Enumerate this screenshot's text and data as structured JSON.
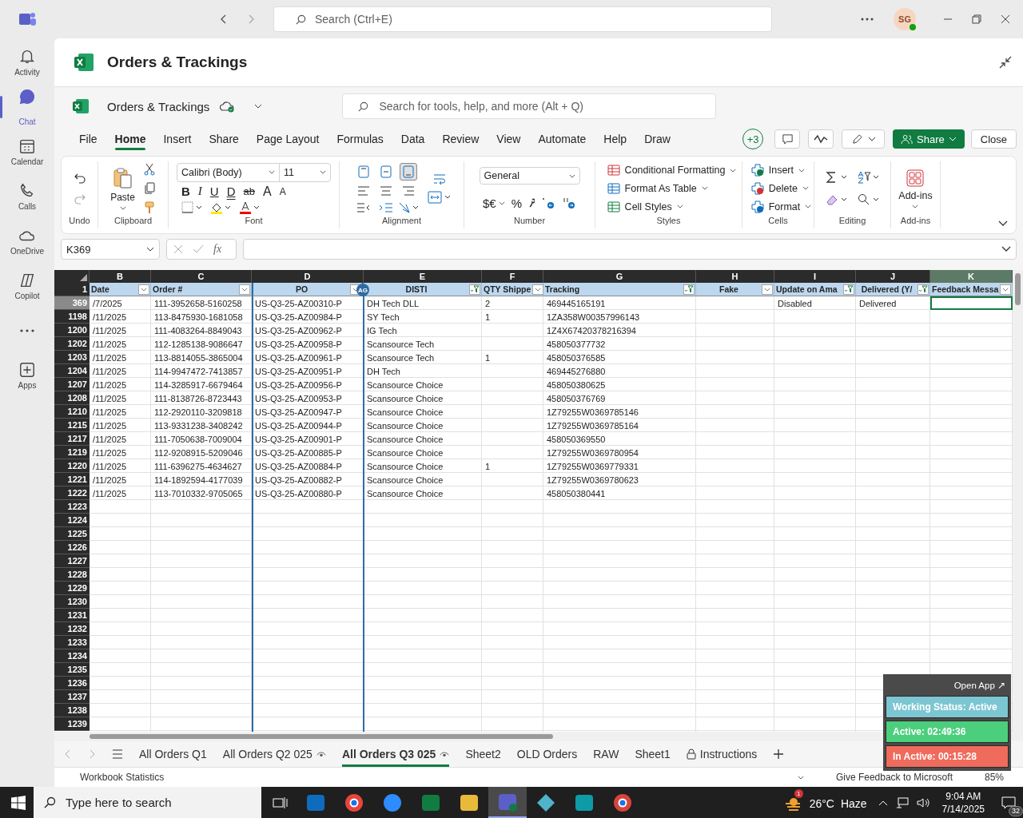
{
  "app_bar": {
    "search_placeholder": "Search (Ctrl+E)",
    "avatar": "SG"
  },
  "rail": [
    {
      "kind": "bell",
      "label": "Activity",
      "selected": false
    },
    {
      "kind": "chat",
      "label": "Chat",
      "selected": true
    },
    {
      "kind": "calendar",
      "label": "Calendar",
      "selected": false
    },
    {
      "kind": "calls",
      "label": "Calls",
      "selected": false
    },
    {
      "kind": "cloud",
      "label": "OneDrive",
      "selected": false
    },
    {
      "kind": "copilot",
      "label": "Copilot",
      "selected": false
    },
    {
      "kind": "more",
      "selected": false
    },
    {
      "kind": "apps",
      "label": "Apps",
      "selected": false
    }
  ],
  "document": {
    "title": "Orders & Trackings"
  },
  "workbook": {
    "name": "Orders & Trackings",
    "search_placeholder": "Search for tools, help, and more (Alt + Q)"
  },
  "menu_tabs": [
    {
      "label": "File",
      "selected": false
    },
    {
      "label": "Home",
      "selected": true
    },
    {
      "label": "Insert",
      "selected": false
    },
    {
      "label": "Share",
      "selected": false
    },
    {
      "label": "Page Layout",
      "selected": false
    },
    {
      "label": "Formulas",
      "selected": false
    },
    {
      "label": "Data",
      "selected": false
    },
    {
      "label": "Review",
      "selected": false
    },
    {
      "label": "View",
      "selected": false
    },
    {
      "label": "Automate",
      "selected": false
    },
    {
      "label": "Help",
      "selected": false
    },
    {
      "label": "Draw",
      "selected": false
    }
  ],
  "toolbar": {
    "collaborators": "+3",
    "share": "Share",
    "close": "Close"
  },
  "ribbon": {
    "undo": {
      "label": "Undo"
    },
    "clipboard": {
      "paste": "Paste",
      "label": "Clipboard"
    },
    "font": {
      "name": "Calibri (Body)",
      "size": "11",
      "label": "Font",
      "buttons": [
        {
          "kind": "bold",
          "label": "B"
        },
        {
          "kind": "italic",
          "label": "I"
        },
        {
          "kind": "underline",
          "label": "U"
        },
        {
          "kind": "double",
          "label": "D"
        },
        {
          "kind": "strike",
          "label": "ab"
        },
        {
          "kind": "grow",
          "label": "A"
        },
        {
          "kind": "shrink",
          "label": "A"
        }
      ]
    },
    "alignment": {
      "label": "Alignment",
      "vertical": [
        {
          "kind": "top",
          "selected": false
        },
        {
          "kind": "middle",
          "selected": false
        },
        {
          "kind": "bottom",
          "selected": true
        }
      ]
    },
    "number": {
      "format": "General",
      "currency": "$€",
      "percent": "%",
      "label": "Number"
    },
    "styles": {
      "label": "Styles",
      "items": [
        {
          "kind": "conditional",
          "label": "Conditional Formatting"
        },
        {
          "kind": "table",
          "label": "Format As Table"
        },
        {
          "kind": "cellstyles",
          "label": "Cell Styles"
        }
      ]
    },
    "cells": {
      "label": "Cells",
      "items": [
        {
          "kind": "insert",
          "label": "Insert"
        },
        {
          "kind": "delete",
          "label": "Delete"
        },
        {
          "kind": "format",
          "label": "Format"
        }
      ]
    },
    "editing": {
      "label": "Editing"
    },
    "addins": {
      "button": "Add-ins",
      "label": "Add-ins"
    }
  },
  "formula_bar": {
    "name_box": "K369",
    "function_label": "fx"
  },
  "sheet": {
    "columns": [
      {
        "letter": "B",
        "header": "Date",
        "filtered": false,
        "selected": false
      },
      {
        "letter": "C",
        "header": "Order #",
        "filtered": false,
        "selected": false
      },
      {
        "letter": "D",
        "header": "PO",
        "filtered": false,
        "selected": false,
        "co_author": "AG"
      },
      {
        "letter": "E",
        "header": "DISTI",
        "filtered": true,
        "selected": false
      },
      {
        "letter": "F",
        "header": "QTY Shippe",
        "filtered": false,
        "selected": false
      },
      {
        "letter": "G",
        "header": "Tracking",
        "filtered": true,
        "selected": false
      },
      {
        "letter": "H",
        "header": "Fake",
        "filtered": false,
        "selected": false
      },
      {
        "letter": "I",
        "header": "Update on Ama",
        "filtered": true,
        "selected": false
      },
      {
        "letter": "J",
        "header": "Delivered (Y/",
        "filtered": true,
        "selected": false
      },
      {
        "letter": "K",
        "header": "Feedback Messa",
        "filtered": false,
        "selected": true
      }
    ],
    "header_row": "1",
    "rows": [
      {
        "number": "369",
        "selected": true,
        "cells": {
          "B": "/7/2025",
          "C": "111-3952658-5160258",
          "D": "US-Q3-25-AZ00310-P",
          "E": "DH Tech DLL",
          "F": "2",
          "G": "469445165191",
          "I": "Disabled",
          "J": "Delivered"
        }
      },
      {
        "number": "1198",
        "selected": false,
        "cells": {
          "B": "/11/2025",
          "C": "113-8475930-1681058",
          "D": "US-Q3-25-AZ00984-P",
          "E": "SY Tech",
          "F": "1",
          "G": "1ZA358W00357996143"
        }
      },
      {
        "number": "1200",
        "selected": false,
        "cells": {
          "B": "/11/2025",
          "C": "111-4083264-8849043",
          "D": "US-Q3-25-AZ00962-P",
          "E": "IG Tech",
          "G": "1Z4X67420378216394"
        }
      },
      {
        "number": "1202",
        "selected": false,
        "cells": {
          "B": "/11/2025",
          "C": "112-1285138-9086647",
          "D": "US-Q3-25-AZ00958-P",
          "E": "Scansource Tech",
          "G": "458050377732"
        }
      },
      {
        "number": "1203",
        "selected": false,
        "cells": {
          "B": "/11/2025",
          "C": "113-8814055-3865004",
          "D": "US-Q3-25-AZ00961-P",
          "E": "Scansource Tech",
          "F": "1",
          "G": "458050376585"
        }
      },
      {
        "number": "1204",
        "selected": false,
        "cells": {
          "B": "/11/2025",
          "C": "114-9947472-7413857",
          "D": "US-Q3-25-AZ00951-P",
          "E": "DH Tech",
          "G": "469445276880"
        }
      },
      {
        "number": "1207",
        "selected": false,
        "cells": {
          "B": "/11/2025",
          "C": "114-3285917-6679464",
          "D": "US-Q3-25-AZ00956-P",
          "E": "Scansource Choice",
          "G": "458050380625"
        }
      },
      {
        "number": "1208",
        "selected": false,
        "cells": {
          "B": "/11/2025",
          "C": "111-8138726-8723443",
          "D": "US-Q3-25-AZ00953-P",
          "E": "Scansource Choice",
          "G": "458050376769"
        }
      },
      {
        "number": "1210",
        "selected": false,
        "cells": {
          "B": "/11/2025",
          "C": "112-2920110-3209818",
          "D": "US-Q3-25-AZ00947-P",
          "E": "Scansource Choice",
          "G": "1Z79255W0369785146"
        }
      },
      {
        "number": "1215",
        "selected": false,
        "cells": {
          "B": "/11/2025",
          "C": "113-9331238-3408242",
          "D": "US-Q3-25-AZ00944-P",
          "E": "Scansource Choice",
          "G": "1Z79255W0369785164"
        }
      },
      {
        "number": "1217",
        "selected": false,
        "cells": {
          "B": "/11/2025",
          "C": "111-7050638-7009004",
          "D": "US-Q3-25-AZ00901-P",
          "E": "Scansource Choice",
          "G": "458050369550"
        }
      },
      {
        "number": "1219",
        "selected": false,
        "cells": {
          "B": "/11/2025",
          "C": "112-9208915-5209046",
          "D": "US-Q3-25-AZ00885-P",
          "E": "Scansource Choice",
          "G": "1Z79255W0369780954"
        }
      },
      {
        "number": "1220",
        "selected": false,
        "cells": {
          "B": "/11/2025",
          "C": "111-6396275-4634627",
          "D": "US-Q3-25-AZ00884-P",
          "E": "Scansource Choice",
          "F": "1",
          "G": "1Z79255W0369779331"
        }
      },
      {
        "number": "1221",
        "selected": false,
        "cells": {
          "B": "/11/2025",
          "C": "114-1892594-4177039",
          "D": "US-Q3-25-AZ00882-P",
          "E": "Scansource Choice",
          "G": "1Z79255W0369780623"
        }
      },
      {
        "number": "1222",
        "selected": false,
        "cells": {
          "B": "/11/2025",
          "C": "113-7010332-9705065",
          "D": "US-Q3-25-AZ00880-P",
          "E": "Scansource Choice",
          "G": "458050380441"
        }
      }
    ],
    "empty_rows": [
      "1223",
      "1224",
      "1225",
      "1226",
      "1227",
      "1228",
      "1229",
      "1230",
      "1231",
      "1232",
      "1233",
      "1234",
      "1235",
      "1236",
      "1237",
      "1238",
      "1239"
    ]
  },
  "sheet_tabs": [
    {
      "label": "All Orders Q1",
      "kind": "plain",
      "selected": false
    },
    {
      "label": "All Orders Q2 025",
      "kind": "watched",
      "selected": false
    },
    {
      "label": "All Orders Q3 025",
      "kind": "watched",
      "selected": true
    },
    {
      "label": "Sheet2",
      "kind": "plain",
      "selected": false
    },
    {
      "label": "OLD Orders",
      "kind": "plain",
      "selected": false
    },
    {
      "label": "RAW",
      "kind": "plain",
      "selected": false
    },
    {
      "label": "Sheet1",
      "kind": "plain",
      "selected": false
    },
    {
      "label": "Instructions",
      "kind": "locked",
      "selected": false
    }
  ],
  "status_bar": {
    "left": "Workbook Statistics",
    "feedback": "Give Feedback to Microsoft",
    "zoom": "85%"
  },
  "tracker_widget": {
    "open_app": "Open App ↗",
    "status": "Working Status: Active",
    "active": "Active: 02:49:36",
    "inactive": "In Active: 00:15:28"
  },
  "taskbar": {
    "search_placeholder": "Type here to search",
    "apps": [
      {
        "kind": "outlook",
        "selected": false
      },
      {
        "kind": "chrome",
        "selected": false
      },
      {
        "kind": "zoom",
        "selected": false
      },
      {
        "kind": "excel",
        "selected": false
      },
      {
        "kind": "explorer",
        "selected": false
      },
      {
        "kind": "teams",
        "selected": true
      },
      {
        "kind": "diamond",
        "selected": false
      },
      {
        "kind": "sway",
        "selected": false
      },
      {
        "kind": "chrome_profile",
        "selected": false
      }
    ],
    "weather": {
      "badge": "1",
      "temp": "26°C",
      "condition": "Haze"
    },
    "time": "9:04 AM",
    "date": "7/14/2025",
    "notifications": "32"
  }
}
